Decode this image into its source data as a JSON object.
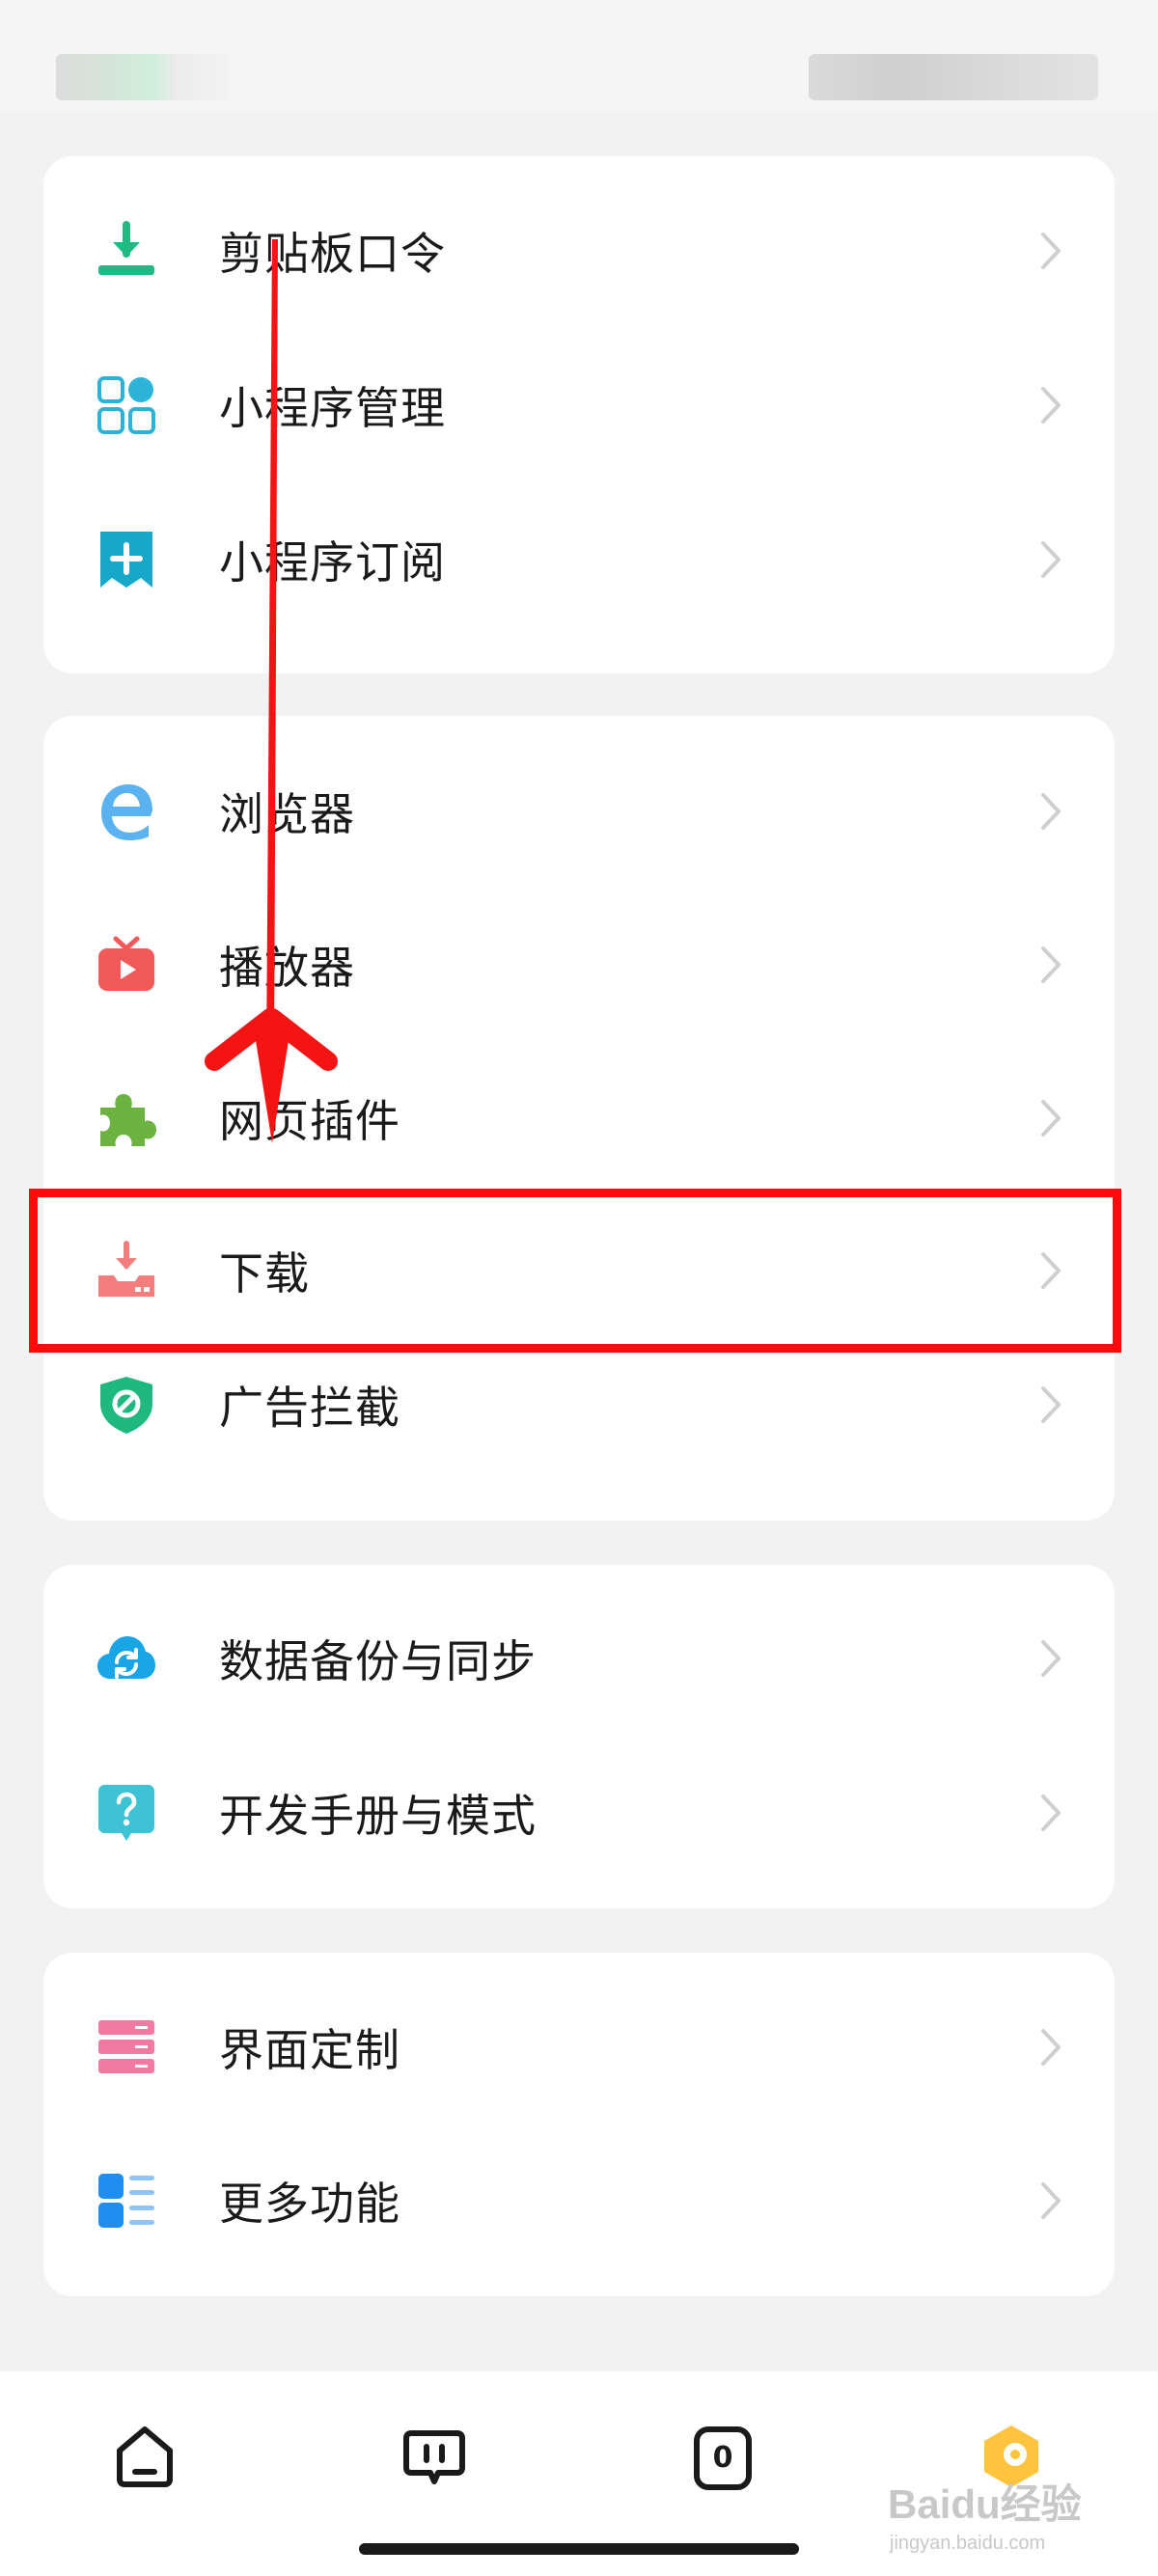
{
  "groups": [
    {
      "items": [
        {
          "label": "剪贴板口令",
          "icon": "clipboard-download-icon"
        },
        {
          "label": "小程序管理",
          "icon": "grid-apps-icon"
        },
        {
          "label": "小程序订阅",
          "icon": "bookmark-plus-icon"
        }
      ]
    },
    {
      "items": [
        {
          "label": "浏览器",
          "icon": "browser-e-icon"
        },
        {
          "label": "播放器",
          "icon": "tv-play-icon"
        },
        {
          "label": "网页插件",
          "icon": "puzzle-icon"
        },
        {
          "label": "下载",
          "icon": "download-tray-icon"
        },
        {
          "label": "广告拦截",
          "icon": "shield-block-icon"
        }
      ]
    },
    {
      "items": [
        {
          "label": "数据备份与同步",
          "icon": "cloud-sync-icon"
        },
        {
          "label": "开发手册与模式",
          "icon": "question-bubble-icon"
        }
      ]
    },
    {
      "items": [
        {
          "label": "界面定制",
          "icon": "layers-icon"
        },
        {
          "label": "更多功能",
          "icon": "list-icon"
        }
      ]
    }
  ],
  "bottom_nav": [
    {
      "name": "home",
      "icon": "home-icon"
    },
    {
      "name": "tabs",
      "icon": "tabs-pause-icon"
    },
    {
      "name": "tab-count",
      "icon": "tab-count-icon",
      "count": "0"
    },
    {
      "name": "profile",
      "icon": "hexagon-avatar-icon"
    }
  ],
  "watermark": {
    "brand": "Baidu经验",
    "url": "jingyan.baidu.com"
  },
  "colors": {
    "highlight": "#ff0a0a",
    "arrow": "#f51414"
  }
}
